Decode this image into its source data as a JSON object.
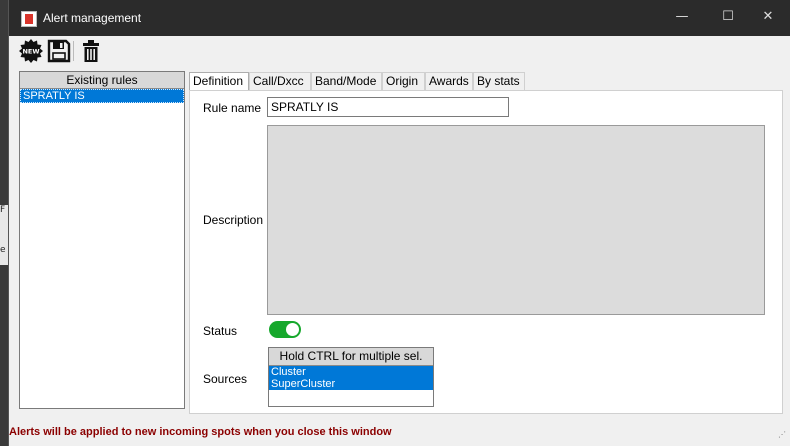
{
  "window": {
    "title": "Alert management",
    "minimize": "—",
    "maximize": "☐",
    "close": "✕"
  },
  "toolbar": {
    "new_label": "NEW"
  },
  "rules": {
    "header": "Existing rules",
    "items": [
      "SPRATLY IS"
    ]
  },
  "tabs": [
    "Definition",
    "Call/Dxcc",
    "Band/Mode",
    "Origin",
    "Awards",
    "By stats"
  ],
  "definition": {
    "rule_name_label": "Rule name",
    "rule_name_value": "SPRATLY IS",
    "description_label": "Description",
    "description_value": "",
    "status_label": "Status",
    "status_on": true,
    "sources_label": "Sources",
    "sources_header": "Hold CTRL for multiple sel.",
    "sources_items": [
      "Cluster",
      "SuperCluster"
    ]
  },
  "status_bar": {
    "message": "Alerts will be applied to new incoming spots when you close this window"
  },
  "background": {
    "fragments": [
      "F",
      "e"
    ]
  },
  "colors": {
    "titlebar": "#2b2b2b",
    "selection": "#0078d7",
    "toggle_on": "#16a82c",
    "status_text": "#8b0000"
  }
}
